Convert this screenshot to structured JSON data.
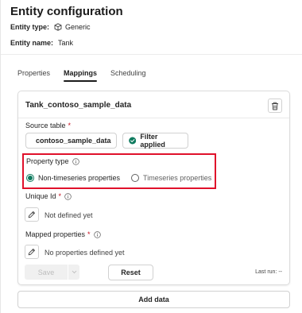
{
  "header": {
    "title": "Entity configuration",
    "entity_type_label": "Entity type:",
    "entity_type_value": "Generic",
    "entity_name_label": "Entity name:",
    "entity_name_value": "Tank"
  },
  "tabs": [
    {
      "label": "Properties",
      "active": false
    },
    {
      "label": "Mappings",
      "active": true
    },
    {
      "label": "Scheduling",
      "active": false
    }
  ],
  "card": {
    "title": "Tank_contoso_sample_data",
    "source_table_label": "Source table",
    "source_table_value": "contoso_sample_data",
    "filter_label": "Filter applied",
    "property_type_label": "Property type",
    "radio_options": [
      {
        "label": "Non-timeseries properties",
        "selected": true
      },
      {
        "label": "Timeseries properties",
        "selected": false
      }
    ],
    "unique_id_label": "Unique Id",
    "unique_id_value": "Not defined yet",
    "mapped_props_label": "Mapped properties",
    "mapped_props_value": "No properties defined yet",
    "save_label": "Save",
    "reset_label": "Reset",
    "last_run": "Last run: --"
  },
  "footer": {
    "add_data_label": "Add data"
  },
  "colors": {
    "accent_green": "#0f7b5f",
    "highlight_red": "#e0112b",
    "required_red": "#c50f1f"
  }
}
